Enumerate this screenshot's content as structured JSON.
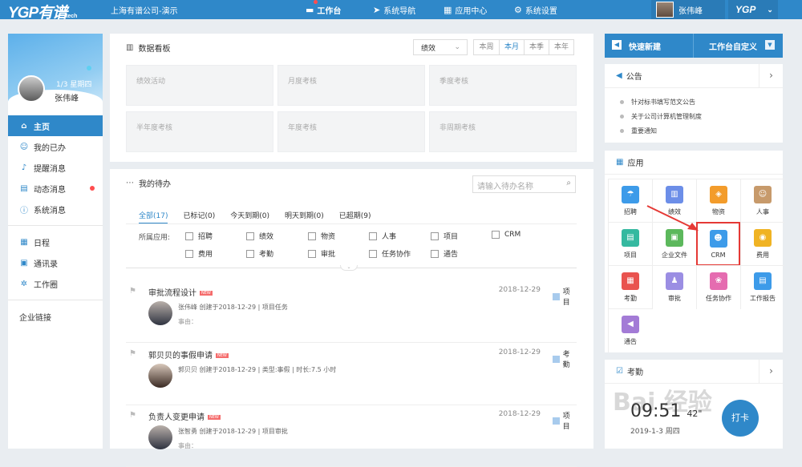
{
  "topbar": {
    "logo": "YGP有谱",
    "logo_sub": "tech",
    "company": "上海有谱公司-演示",
    "nav": [
      {
        "icon": "monitor-icon",
        "glyph": "▬",
        "label": "工作台",
        "active": true
      },
      {
        "icon": "navigation-arrow-icon",
        "glyph": "➤",
        "label": "系统导航"
      },
      {
        "icon": "app-center-icon",
        "glyph": "▦",
        "label": "应用中心"
      },
      {
        "icon": "gear-icon",
        "glyph": "⚙",
        "label": "系统设置"
      }
    ],
    "user_name": "张伟峰",
    "ygp_menu": "YGP"
  },
  "sidebar": {
    "date": "1/3 星期四",
    "name": "张伟峰",
    "items": [
      {
        "label": "主页",
        "icon": "home-icon",
        "glyph": "⌂",
        "active": true
      },
      {
        "label": "我的已办",
        "icon": "user-icon",
        "glyph": "☺"
      },
      {
        "label": "提醒消息",
        "icon": "bell-icon",
        "glyph": "♪"
      },
      {
        "label": "动态消息",
        "icon": "chat-icon",
        "glyph": "▤",
        "dot": true
      },
      {
        "label": "系统消息",
        "icon": "info-icon",
        "glyph": "ⓘ"
      }
    ],
    "items2": [
      {
        "label": "日程",
        "icon": "calendar-icon",
        "glyph": "▦"
      },
      {
        "label": "通讯录",
        "icon": "contacts-icon",
        "glyph": "▣"
      },
      {
        "label": "工作圈",
        "icon": "circle-icon",
        "glyph": "✲"
      }
    ],
    "link": "企业链接"
  },
  "dashboard": {
    "title": "数据看板",
    "select_value": "绩效",
    "periods": [
      "本周",
      "本月",
      "本季",
      "本年"
    ],
    "active_period": "本月",
    "tiles": [
      "绩效活动",
      "月度考核",
      "季度考核",
      "半年度考核",
      "年度考核",
      "非周期考核"
    ]
  },
  "todo": {
    "title": "我的待办",
    "search_placeholder": "请输入待办名称",
    "tabs": [
      "全部(17)",
      "已标记(0)",
      "今天到期(0)",
      "明天到期(0)",
      "已超期(9)"
    ],
    "filter_label": "所属应用:",
    "filters": [
      "招聘",
      "绩效",
      "物资",
      "人事",
      "项目",
      "CRM",
      "费用",
      "考勤",
      "审批",
      "任务协作",
      "通告"
    ],
    "items": [
      {
        "title": "审批流程设计",
        "new": "NEW",
        "date": "2018-12-29",
        "tag": "项目",
        "meta": "张伟峰   创建于2018-12-29  |  项目任务",
        "reason": "事由："
      },
      {
        "title": "郭贝贝的事假申请",
        "new": "NEW",
        "date": "2018-12-29",
        "tag": "考勤",
        "meta": "郭贝贝   创建于2018-12-29  |  类型:事假  |  时长:7.5 小时",
        "reason": ""
      },
      {
        "title": "负责人变更申请",
        "new": "NEW",
        "date": "2018-12-29",
        "tag": "项目",
        "meta": "张智勇   创建于2018-12-29  |  项目审批",
        "reason": "事由："
      }
    ]
  },
  "quick": {
    "new_label": "快速新建",
    "customize_label": "工作台自定义"
  },
  "announcement": {
    "title": "公告",
    "items": [
      "针对标书填写范文公告",
      "关于公司计算机管理制度",
      "重要通知"
    ]
  },
  "apps": {
    "title": "应用",
    "items": [
      {
        "label": "招聘",
        "color": "#3d9be9",
        "glyph": "☂"
      },
      {
        "label": "绩效",
        "color": "#6c8ee8",
        "glyph": "▥"
      },
      {
        "label": "物资",
        "color": "#f39c2b",
        "glyph": "◈"
      },
      {
        "label": "人事",
        "color": "#c79a6b",
        "glyph": "☺"
      },
      {
        "label": "项目",
        "color": "#35b9a0",
        "glyph": "▤"
      },
      {
        "label": "企业文件",
        "color": "#5cb85c",
        "glyph": "▣"
      },
      {
        "label": "CRM",
        "color": "#3d9be9",
        "glyph": "☻",
        "highlight": true
      },
      {
        "label": "费用",
        "color": "#f0b323",
        "glyph": "◉"
      },
      {
        "label": "考勤",
        "color": "#e9534f",
        "glyph": "▦"
      },
      {
        "label": "审批",
        "color": "#9b8ee3",
        "glyph": "♟"
      },
      {
        "label": "任务协作",
        "color": "#e56cb0",
        "glyph": "❀"
      },
      {
        "label": "工作报告",
        "color": "#3d9be9",
        "glyph": "▤"
      },
      {
        "label": "通告",
        "color": "#a37bd6",
        "glyph": "◀"
      }
    ]
  },
  "attendance": {
    "title": "考勤",
    "time": "09:51",
    "seconds": "42\"",
    "date": "2019-1-3 周四",
    "punch": "打卡",
    "watermark": "Bai 经验"
  }
}
